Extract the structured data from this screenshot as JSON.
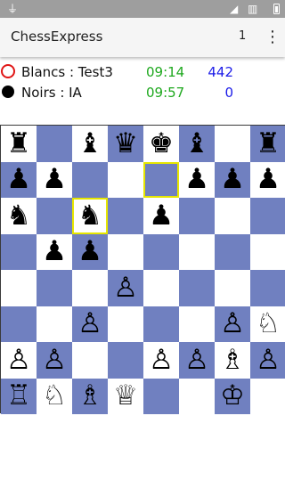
{
  "app": {
    "title": "ChessExpress",
    "counter": "1"
  },
  "players": {
    "white": {
      "label": "Blancs : Test3",
      "time": "09:14",
      "score": "442"
    },
    "black": {
      "label": "Noirs : IA",
      "time": "09:57",
      "score": "0"
    }
  },
  "colors": {
    "dark_square": "#7080c0",
    "light_square": "#ffffff",
    "highlight": "#e6e600",
    "time": "#1ea81e",
    "score": "#1c1ce8",
    "white_marker": "#e01515"
  },
  "board": {
    "rows": [
      [
        "♜",
        "",
        "♝",
        "♛",
        "♚",
        "♝",
        "",
        "♜"
      ],
      [
        "♟",
        "♟",
        "",
        "",
        "",
        "♟",
        "♟",
        "♟"
      ],
      [
        "♞",
        "",
        "♞",
        "",
        "♟",
        "",
        "",
        ""
      ],
      [
        "",
        "♟",
        "♟",
        "",
        "",
        "",
        "",
        ""
      ],
      [
        "",
        "",
        "",
        "♙",
        "",
        "",
        "",
        ""
      ],
      [
        "",
        "",
        "♙",
        "",
        "",
        "",
        "♙",
        "♘"
      ],
      [
        "♙",
        "♙",
        "",
        "",
        "♙",
        "♙",
        "♗",
        "♙"
      ],
      [
        "♖",
        "♘",
        "♗",
        "♕",
        "",
        "",
        "♔",
        ""
      ]
    ],
    "highlighted": [
      "e7",
      "c6"
    ]
  }
}
